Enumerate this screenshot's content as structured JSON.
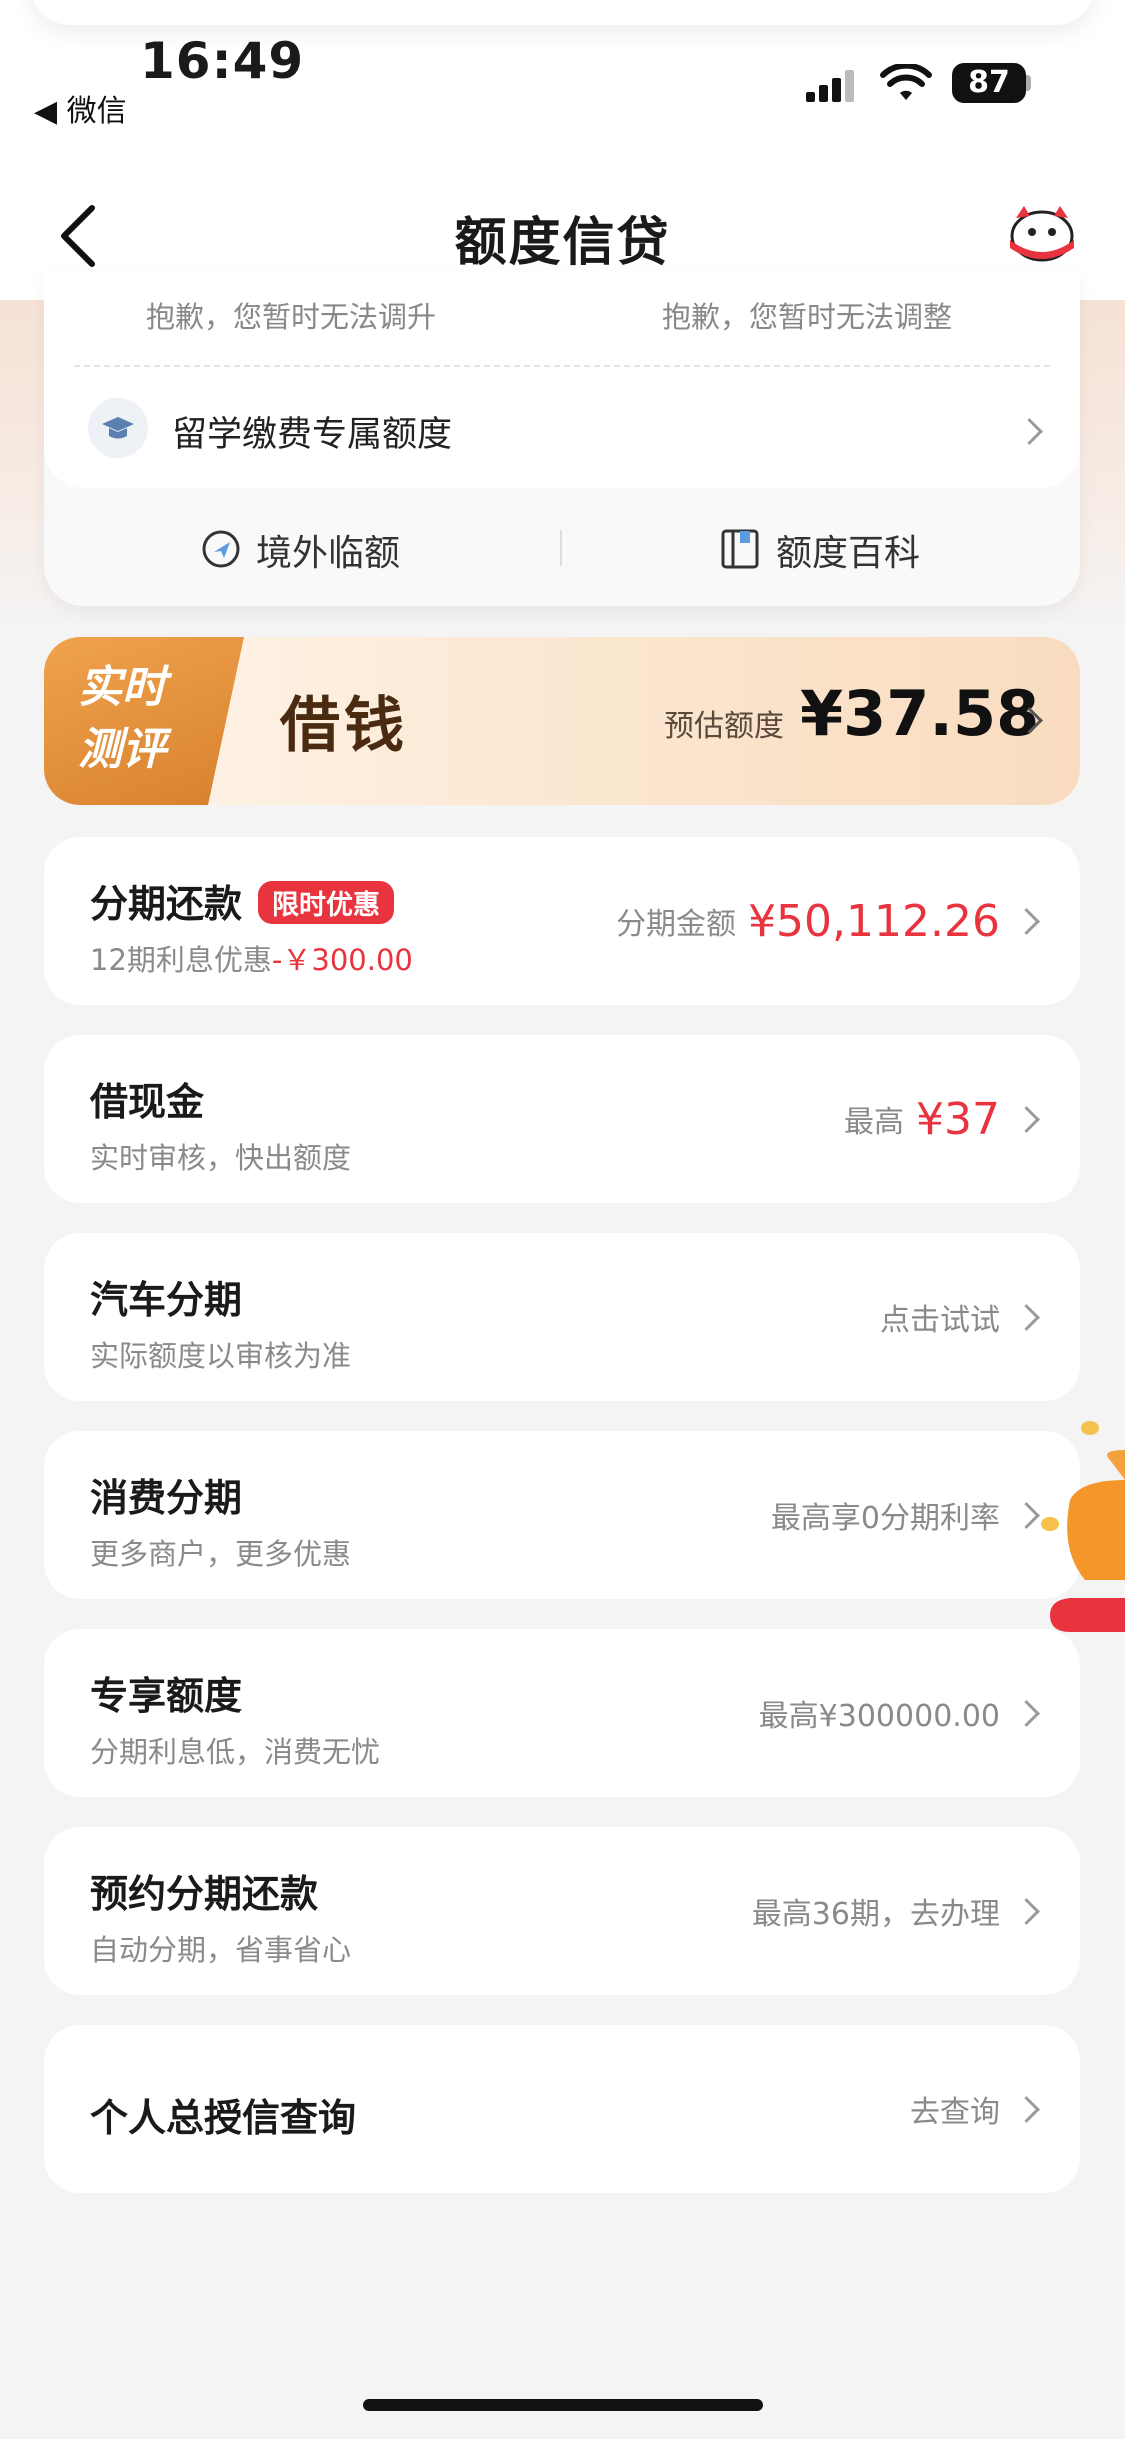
{
  "status_bar": {
    "time": "16:49",
    "back_app": "◀ 微信",
    "battery": "87"
  },
  "nav": {
    "title": "额度信贷"
  },
  "credit_card": {
    "raise_status": "抱歉，您暂时无法调升",
    "adjust_status": "抱歉，您暂时无法调整",
    "study_label": "留学缴费专属额度",
    "action_overseas": "境外临额",
    "action_wiki": "额度百科"
  },
  "banner": {
    "tag_line1": "实时",
    "tag_line2": "测评",
    "title": "借钱",
    "estimate_label": "预估额度",
    "estimate_amount": "¥37.58"
  },
  "items": [
    {
      "title": "分期还款",
      "badge": "限时优惠",
      "subtitle": "12期利息优惠",
      "subtitle_discount": "-￥300.00",
      "right_label": "分期金额",
      "right_value": "¥50,112.26"
    },
    {
      "title": "借现金",
      "subtitle": "实时审核，快出额度",
      "right_label": "最高",
      "right_value": "¥37"
    },
    {
      "title": "汽车分期",
      "subtitle": "实际额度以审核为准",
      "right_label": "点击试试"
    },
    {
      "title": "消费分期",
      "subtitle": "更多商户，更多优惠",
      "right_label": "最高享0分期利率"
    },
    {
      "title": "专享额度",
      "subtitle": "分期利息低，消费无忧",
      "right_label": "最高¥300000.00"
    },
    {
      "title": "预约分期还款",
      "subtitle": "自动分期，省事省心",
      "right_label": "最高36期，去办理"
    },
    {
      "title": "个人总授信查询",
      "right_label": "去查询"
    }
  ],
  "colors": {
    "accent_red": "#e8343e",
    "banner_orange": "#d7812e",
    "page_bg": "#f4f4f4"
  }
}
